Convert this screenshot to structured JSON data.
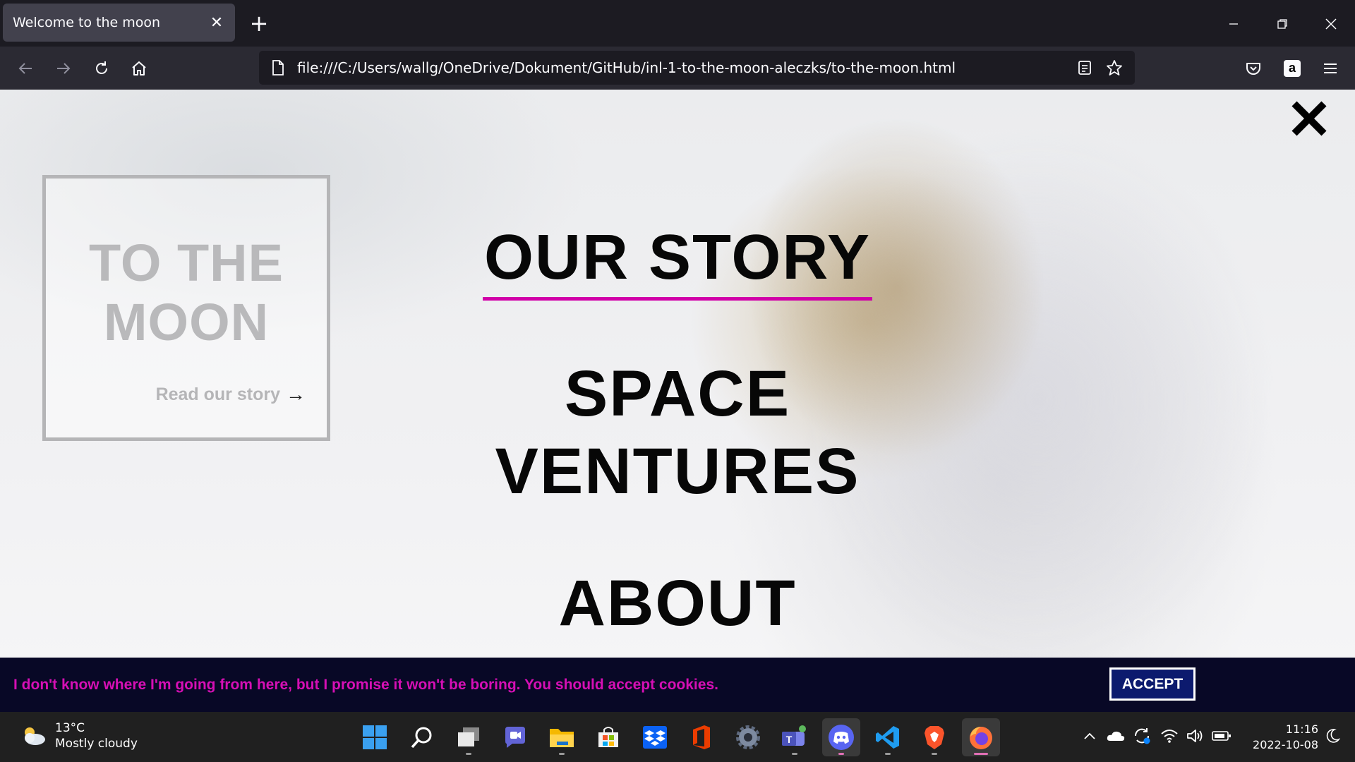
{
  "browser": {
    "tab_title": "Welcome to the moon",
    "url": "file:///C:/Users/wallg/OneDrive/Dokument/GitHub/inl-1-to-the-moon-aleczks/to-the-moon.html"
  },
  "page": {
    "hero": {
      "title_line1": "TO THE",
      "title_line2": "MOON",
      "link_label": "Read our story",
      "link_arrow": "→"
    },
    "menu": {
      "items": [
        {
          "label": "OUR STORY"
        },
        {
          "label_line1": "SPACE",
          "label_line2": "VENTURES"
        },
        {
          "label": "ABOUT"
        }
      ],
      "active_underline_color": "#d100a8"
    },
    "cookie_banner": {
      "message": "I don't know where I'm going from here, but I promise it won't be boring. You should accept cookies.",
      "accept_label": "ACCEPT",
      "text_color": "#d60fb5"
    }
  },
  "taskbar": {
    "weather": {
      "temp": "13°C",
      "condition": "Mostly cloudy"
    },
    "clock": {
      "time": "11:16",
      "date": "2022-10-08"
    },
    "apps": [
      "start-icon",
      "search-icon",
      "task-view-icon",
      "chat-icon",
      "file-explorer-icon",
      "store-icon",
      "dropbox-icon",
      "office-icon",
      "settings-icon",
      "teams-icon",
      "discord-icon",
      "vscode-icon",
      "brave-icon",
      "firefox-icon"
    ]
  }
}
